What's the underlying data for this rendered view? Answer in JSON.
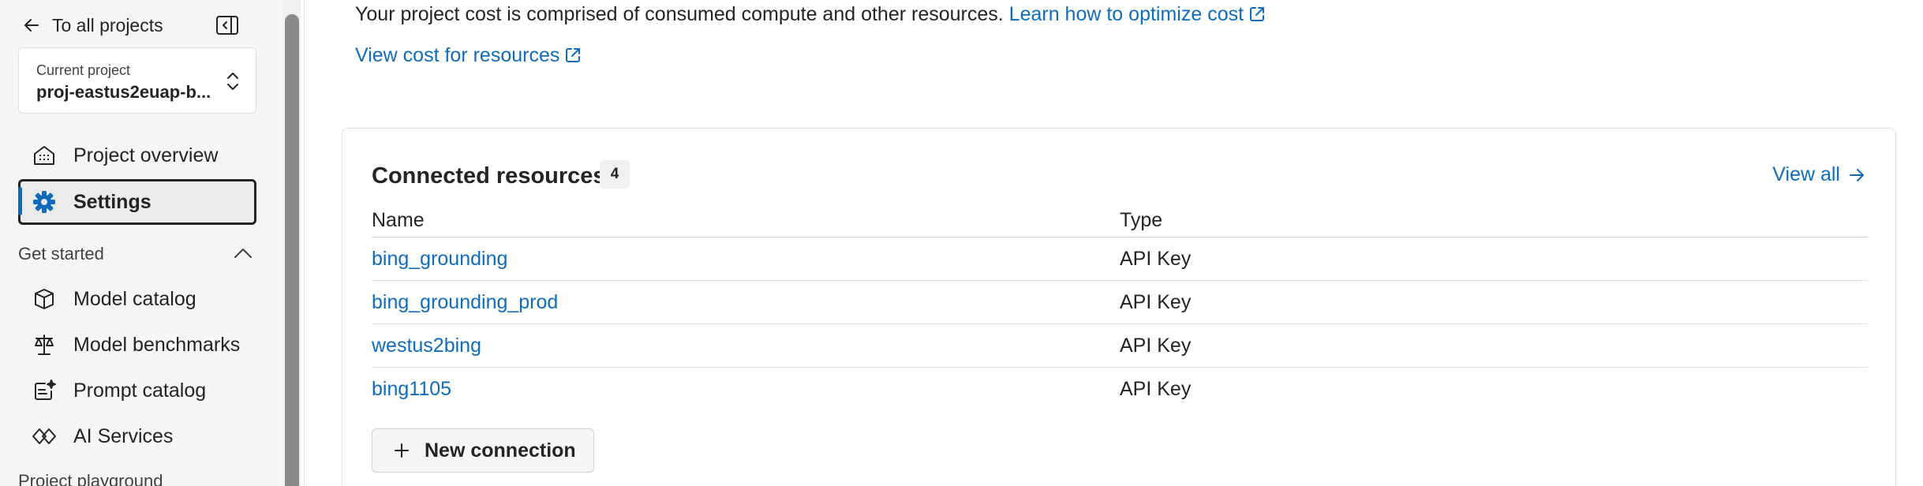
{
  "sidebar": {
    "back_label": "To all projects",
    "project_caption": "Current project",
    "project_name": "proj-eastus2euap-b...",
    "items": [
      {
        "label": "Project overview",
        "icon": "building-icon"
      },
      {
        "label": "Settings",
        "icon": "gear-icon",
        "active": true
      }
    ],
    "section_get_started": "Get started",
    "get_started_items": [
      {
        "label": "Model catalog",
        "icon": "cube-icon"
      },
      {
        "label": "Model benchmarks",
        "icon": "scales-icon"
      },
      {
        "label": "Prompt catalog",
        "icon": "prompt-sparkle-icon"
      },
      {
        "label": "AI Services",
        "icon": "diamond-link-icon"
      }
    ],
    "section_cut_label": "Project playground"
  },
  "main": {
    "cost_text": "Your project cost is comprised of consumed compute and other resources.",
    "optimize_link": "Learn how to optimize cost",
    "view_cost_link": "View cost for resources",
    "connected": {
      "title": "Connected resources",
      "count": "4",
      "view_all": "View all",
      "columns": [
        "Name",
        "Type"
      ],
      "rows": [
        {
          "name": "bing_grounding",
          "type": "API Key"
        },
        {
          "name": "bing_grounding_prod",
          "type": "API Key"
        },
        {
          "name": "westus2bing",
          "type": "API Key"
        },
        {
          "name": "bing1105",
          "type": "API Key"
        }
      ],
      "new_connection": "New connection"
    }
  },
  "colors": {
    "accent": "#0f6cbd",
    "text": "#242424",
    "sidebar_bg": "#f5f5f5"
  }
}
